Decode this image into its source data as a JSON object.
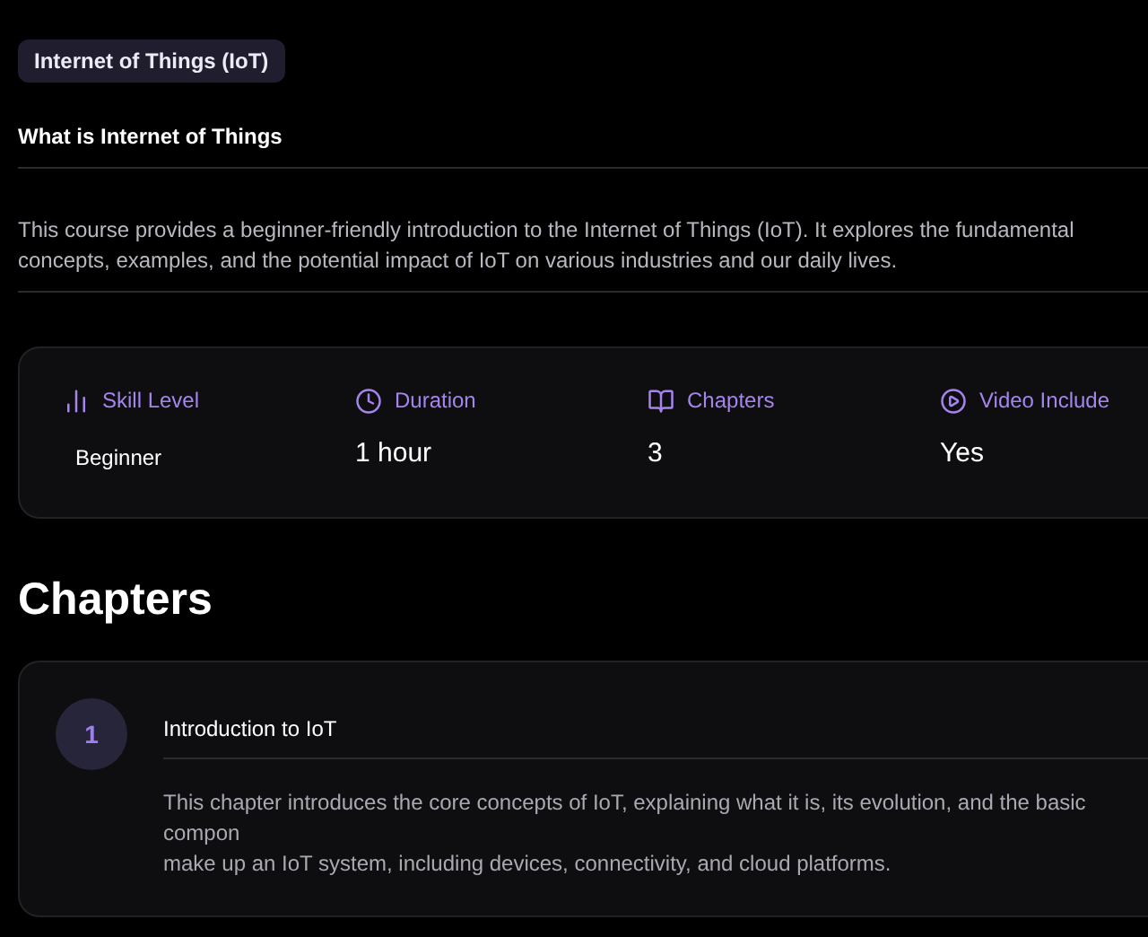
{
  "tag": "Internet of Things (IoT)",
  "section_title": "What is Internet of Things",
  "description": "This course provides a beginner-friendly introduction to the Internet of Things (IoT). It explores the fundamental concepts, examples, and the potential impact of IoT on various industries and our daily lives.",
  "stats": [
    {
      "kind": "level",
      "label": "Skill Level",
      "value": "Beginner"
    },
    {
      "kind": "duration",
      "label": "Duration",
      "value": "1 hour"
    },
    {
      "kind": "chapters",
      "label": "Chapters",
      "value": "3"
    },
    {
      "kind": "video",
      "label": "Video Include",
      "value": "Yes"
    }
  ],
  "chapters_heading": "Chapters",
  "chapters": [
    {
      "number": "1",
      "title": "Introduction to IoT",
      "description_lines": [
        "This chapter introduces the core concepts of IoT, explaining what it is, its evolution, and the basic compon",
        "make up an IoT system, including devices, connectivity, and cloud platforms."
      ]
    }
  ]
}
